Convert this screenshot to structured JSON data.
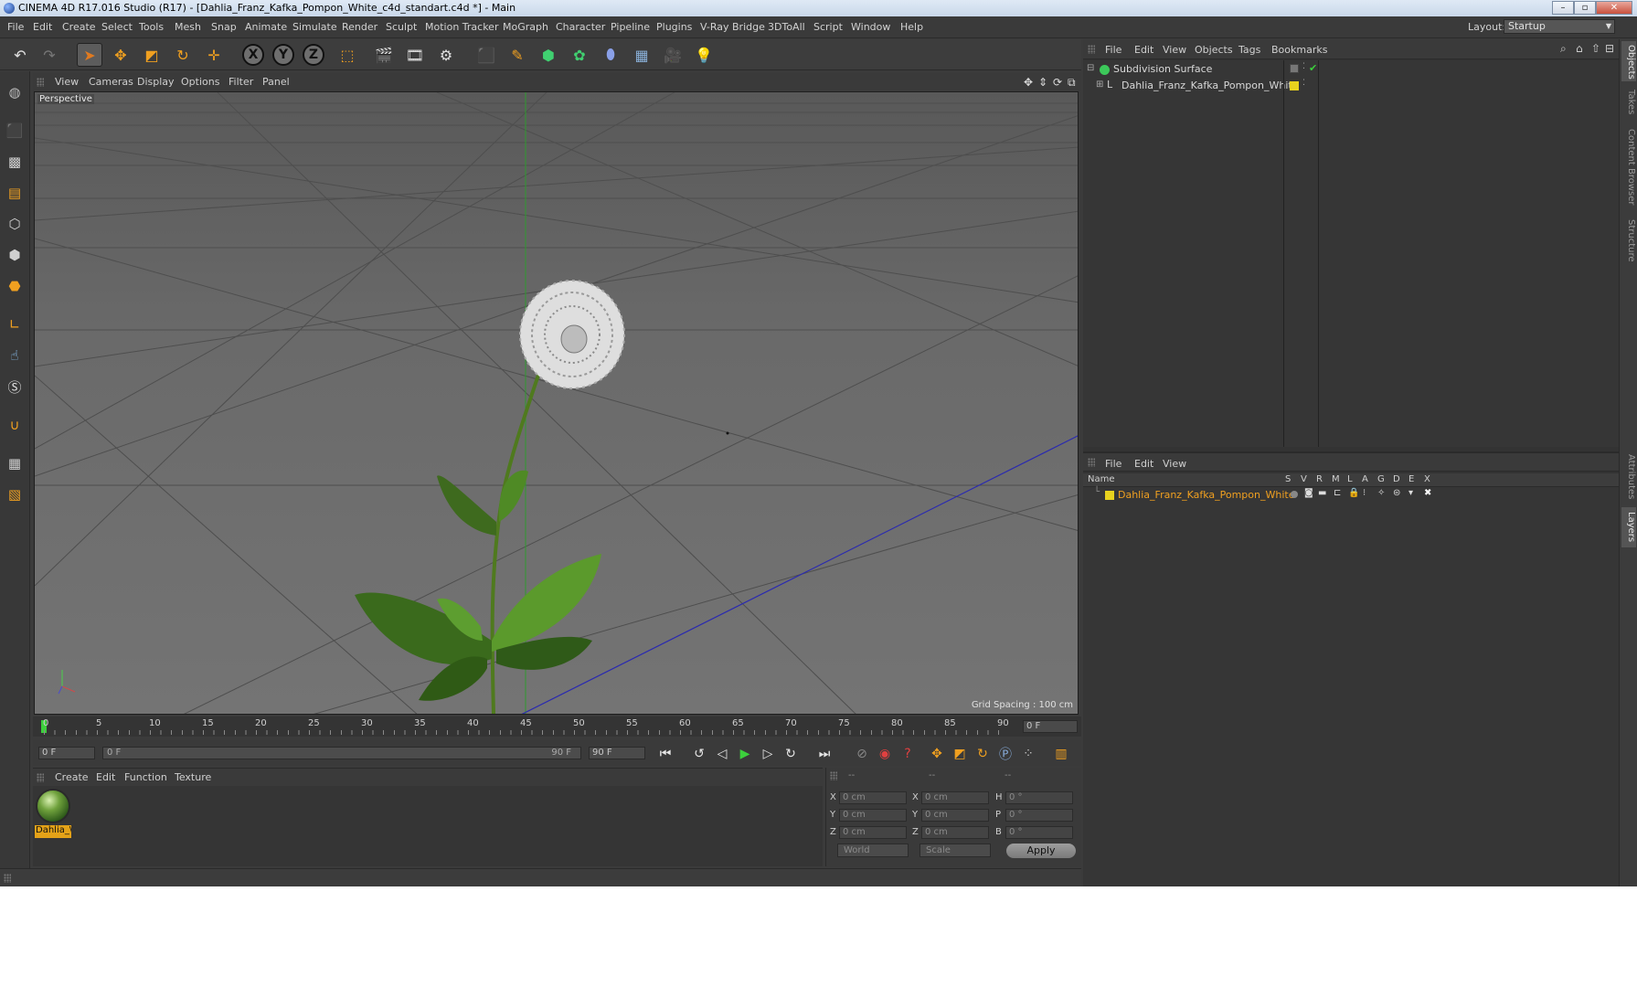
{
  "window": {
    "title": "CINEMA 4D R17.016 Studio (R17) - [Dahlia_Franz_Kafka_Pompon_White_c4d_standart.c4d *] - Main"
  },
  "menubar": {
    "items": [
      "File",
      "Edit",
      "Create",
      "Select",
      "Tools",
      "Mesh",
      "Snap",
      "Animate",
      "Simulate",
      "Render",
      "Sculpt",
      "Motion Tracker",
      "MoGraph",
      "Character",
      "Pipeline",
      "Plugins",
      "V-Ray Bridge",
      "3DToAll",
      "Script",
      "Window",
      "Help"
    ],
    "layout_label": "Layout:",
    "layout_value": "Startup"
  },
  "toolbar": {
    "axis_x": "X",
    "axis_y": "Y",
    "axis_z": "Z"
  },
  "viewport": {
    "menu": [
      "View",
      "Cameras",
      "Display",
      "Options",
      "Filter",
      "Panel"
    ],
    "label": "Perspective",
    "grid_spacing": "Grid Spacing : 100 cm"
  },
  "timeline": {
    "ticks": [
      "0",
      "5",
      "10",
      "15",
      "20",
      "25",
      "30",
      "35",
      "40",
      "45",
      "50",
      "55",
      "60",
      "65",
      "70",
      "75",
      "80",
      "85",
      "90"
    ],
    "current_frame_right": "0 F",
    "start_field": "0 F",
    "range_start": "0 F",
    "range_end": "90 F",
    "end_field": "90 F"
  },
  "material_manager": {
    "menu": [
      "Create",
      "Edit",
      "Function",
      "Texture"
    ],
    "materials": [
      {
        "name": "Dahlia_\\"
      }
    ]
  },
  "coordinates": {
    "headers": [
      "--",
      "--",
      "--"
    ],
    "rows": [
      {
        "a": "X",
        "av": "0 cm",
        "b": "X",
        "bv": "0 cm",
        "c": "H",
        "cv": "0 °"
      },
      {
        "a": "Y",
        "av": "0 cm",
        "b": "Y",
        "bv": "0 cm",
        "c": "P",
        "cv": "0 °"
      },
      {
        "a": "Z",
        "av": "0 cm",
        "b": "Z",
        "bv": "0 cm",
        "c": "B",
        "cv": "0 °"
      }
    ],
    "mode": "World",
    "scale": "Scale",
    "apply": "Apply"
  },
  "object_manager": {
    "menu": [
      "File",
      "Edit",
      "View",
      "Objects",
      "Tags",
      "Bookmarks"
    ],
    "objects": [
      {
        "name": "Subdivision Surface"
      },
      {
        "name": "Dahlia_Franz_Kafka_Pompon_White"
      }
    ]
  },
  "layer_manager": {
    "menu": [
      "File",
      "Edit",
      "View"
    ],
    "columns": [
      "Name",
      "S",
      "V",
      "R",
      "M",
      "L",
      "A",
      "G",
      "D",
      "E",
      "X"
    ],
    "layers": [
      {
        "name": "Dahlia_Franz_Kafka_Pompon_White",
        "color": "#e8d21e"
      }
    ]
  },
  "right_tabs": [
    "Objects",
    "Takes",
    "Content Browser",
    "Structure",
    "Attributes",
    "Layers"
  ],
  "colors": {
    "accent_orange": "#e4a218",
    "layer_text": "#f0a020",
    "play_green": "#3ccf3c"
  }
}
